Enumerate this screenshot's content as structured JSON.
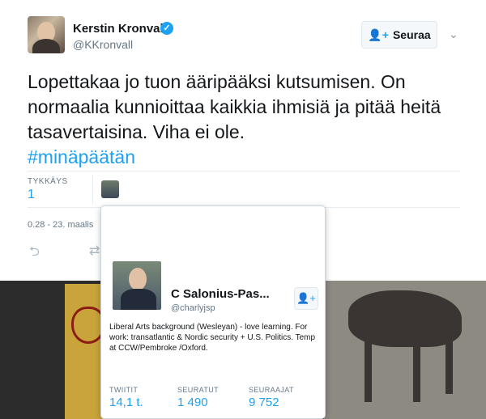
{
  "tweet": {
    "author_name": "Kerstin Kronvall",
    "author_handle": "@KKronvall",
    "follow_label": "Seuraa",
    "text": "Lopettakaa jo tuon ääripääksi kutsumisen. On normaalia kunnioittaa kaikkia ihmisiä ja pitää heitä tasavertaisina. Viha ei ole.",
    "hashtag": "#minäpäätän",
    "likes_label": "TYKKÄYS",
    "likes_value": "1",
    "timestamp": "0.28 - 23. maalis"
  },
  "hover_card": {
    "name": "C Salonius-Pas...",
    "handle": "@charlyjsp",
    "bio": "Liberal Arts background (Wesleyan) - love learning. For work: transatlantic & Nordic security + U.S. Politics. Temp at CCW/Pembroke /Oxford.",
    "stats": [
      {
        "label": "TWIITIT",
        "value": "14,1 t."
      },
      {
        "label": "SEURATUT",
        "value": "1 490"
      },
      {
        "label": "SEURAAJAT",
        "value": "9 752"
      }
    ]
  },
  "icons": {
    "verified": "verified-badge-icon",
    "follow": "add-user-icon",
    "caret": "chevron-down-icon",
    "reply": "reply-icon",
    "retweet": "retweet-icon"
  },
  "colors": {
    "link": "#1da1f2",
    "muted": "#657786"
  }
}
